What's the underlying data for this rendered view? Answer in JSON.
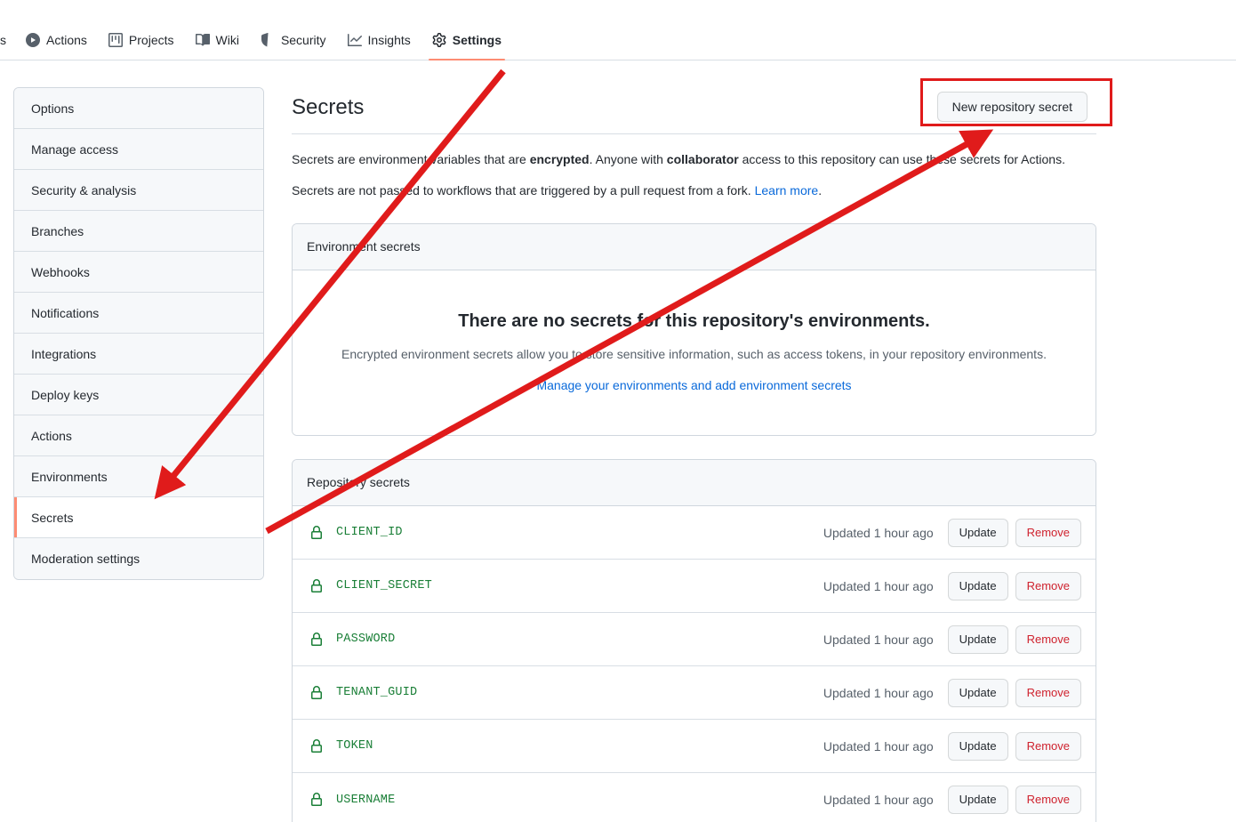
{
  "repo_nav": {
    "truncated_left_label": "s",
    "items": [
      {
        "label": "Actions",
        "icon": "play-circle-icon",
        "selected": false
      },
      {
        "label": "Projects",
        "icon": "project-board-icon",
        "selected": false
      },
      {
        "label": "Wiki",
        "icon": "book-icon",
        "selected": false
      },
      {
        "label": "Security",
        "icon": "shield-alert-icon",
        "selected": false
      },
      {
        "label": "Insights",
        "icon": "graph-icon",
        "selected": false
      },
      {
        "label": "Settings",
        "icon": "gear-icon",
        "selected": true
      }
    ]
  },
  "sidebar": {
    "items": [
      {
        "label": "Options",
        "active": false
      },
      {
        "label": "Manage access",
        "active": false
      },
      {
        "label": "Security & analysis",
        "active": false
      },
      {
        "label": "Branches",
        "active": false
      },
      {
        "label": "Webhooks",
        "active": false
      },
      {
        "label": "Notifications",
        "active": false
      },
      {
        "label": "Integrations",
        "active": false
      },
      {
        "label": "Deploy keys",
        "active": false
      },
      {
        "label": "Actions",
        "active": false
      },
      {
        "label": "Environments",
        "active": false
      },
      {
        "label": "Secrets",
        "active": true
      },
      {
        "label": "Moderation settings",
        "active": false
      }
    ]
  },
  "main": {
    "title": "Secrets",
    "new_secret_button": "New repository secret",
    "description_1": {
      "part_1": "Secrets are environment variables that are ",
      "bold_1": "encrypted",
      "part_2": ". Anyone with ",
      "bold_2": "collaborator",
      "part_3": " access to this repository can use these secrets for Actions."
    },
    "description_2": {
      "part_1": "Secrets are not passed to workflows that are triggered by a pull request from a fork. ",
      "link": "Learn more",
      "part_2": "."
    },
    "environment_secrets": {
      "header": "Environment secrets",
      "empty_title": "There are no secrets for this repository's environments.",
      "empty_subtitle": "Encrypted environment secrets allow you to store sensitive information, such as access tokens, in your repository environments.",
      "empty_link": "Manage your environments and add environment secrets"
    },
    "repository_secrets": {
      "header": "Repository secrets",
      "update_label": "Update",
      "remove_label": "Remove",
      "rows": [
        {
          "name": "CLIENT_ID",
          "updated": "Updated 1 hour ago",
          "icon": "lock-icon"
        },
        {
          "name": "CLIENT_SECRET",
          "updated": "Updated 1 hour ago",
          "icon": "lock-icon"
        },
        {
          "name": "PASSWORD",
          "updated": "Updated 1 hour ago",
          "icon": "lock-icon"
        },
        {
          "name": "TENANT_GUID",
          "updated": "Updated 1 hour ago",
          "icon": "lock-icon"
        },
        {
          "name": "TOKEN",
          "updated": "Updated 1 hour ago",
          "icon": "lock-icon"
        },
        {
          "name": "USERNAME",
          "updated": "Updated 1 hour ago",
          "icon": "lock-icon"
        }
      ]
    }
  },
  "annotations": {
    "highlight_color": "#e01b1b",
    "arrow_color": "#e01b1b",
    "box_target": "New repository secret",
    "arrow_1_target": "Secrets sidebar item",
    "arrow_2_target": "New repository secret button"
  },
  "theme": {
    "accent_orange": "#fd8c73",
    "link_blue": "#0969da",
    "secret_green": "#1a7f37",
    "danger_red": "#cf222e",
    "muted_text": "#57606a",
    "border": "#d0d7de",
    "panel_head_bg": "#f6f8fa"
  }
}
